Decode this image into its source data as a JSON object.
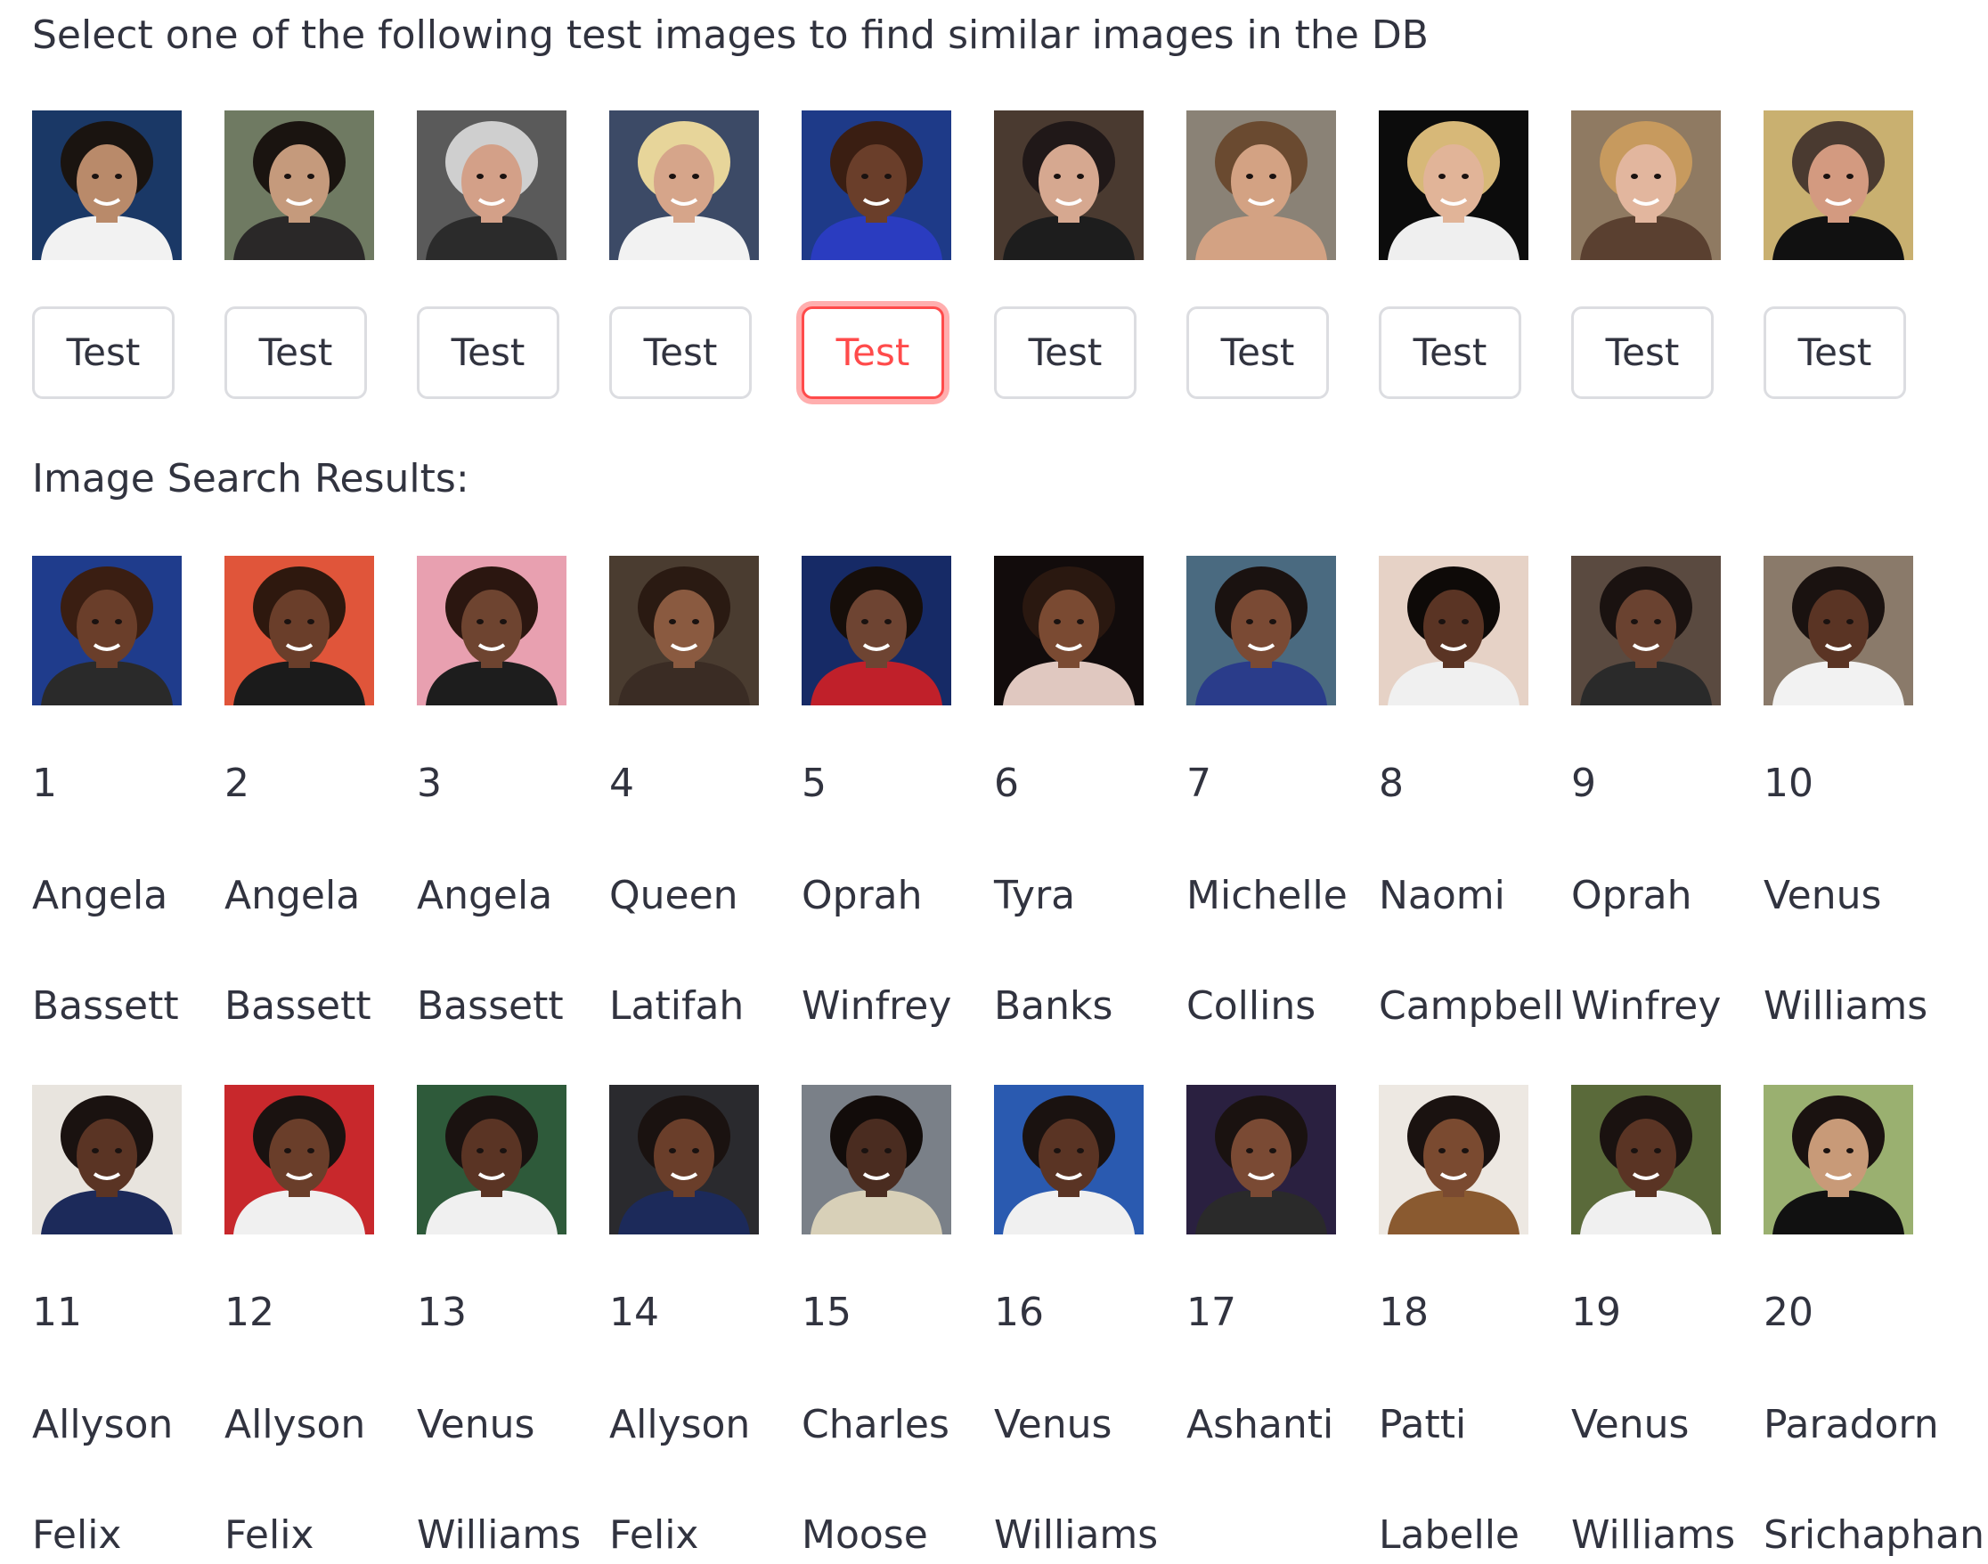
{
  "header": {
    "instruction": "Select one of the following test images to find similar images in the DB"
  },
  "test_images": [
    {
      "button_label": "Test",
      "selected": false,
      "background": "#1a3866",
      "skin": "#b98a6a",
      "hair": "#1a1410",
      "clothes": "#f2f2f2"
    },
    {
      "button_label": "Test",
      "selected": false,
      "background": "#6f7a62",
      "skin": "#c59a7c",
      "hair": "#1a1410",
      "clothes": "#2a2828"
    },
    {
      "button_label": "Test",
      "selected": false,
      "background": "#5a5a5a",
      "skin": "#d3a088",
      "hair": "#cfcfcf",
      "clothes": "#2b2b2b"
    },
    {
      "button_label": "Test",
      "selected": false,
      "background": "#3c4a66",
      "skin": "#d6a58a",
      "hair": "#e7d59a",
      "clothes": "#f2f2f2"
    },
    {
      "button_label": "Test",
      "selected": true,
      "background": "#1e3a88",
      "skin": "#6a3e2a",
      "hair": "#3a1e12",
      "clothes": "#2a3cc0"
    },
    {
      "button_label": "Test",
      "selected": false,
      "background": "#4a3a30",
      "skin": "#d6a890",
      "hair": "#201818",
      "clothes": "#1d1d1d"
    },
    {
      "button_label": "Test",
      "selected": false,
      "background": "#8a8276",
      "skin": "#d3a283",
      "hair": "#6a4a30",
      "clothes": "#d3a283"
    },
    {
      "button_label": "Test",
      "selected": false,
      "background": "#0c0c0c",
      "skin": "#e1b498",
      "hair": "#d7b878",
      "clothes": "#efefef"
    },
    {
      "button_label": "Test",
      "selected": false,
      "background": "#8f7a62",
      "skin": "#e2b69e",
      "hair": "#c79a5e",
      "clothes": "#5a4030"
    },
    {
      "button_label": "Test",
      "selected": false,
      "background": "#c9b070",
      "skin": "#d39a80",
      "hair": "#4a3a30",
      "clothes": "#111111"
    }
  ],
  "results_heading": "Image Search Results:",
  "results": [
    {
      "rank": "1",
      "first": "Angela",
      "last": "Bassett",
      "background": "#1f3c8c",
      "skin": "#6a3e2a",
      "hair": "#3a1e12",
      "clothes": "#2a2a2a"
    },
    {
      "rank": "2",
      "first": "Angela",
      "last": "Bassett",
      "background": "#e0553a",
      "skin": "#6a3e2a",
      "hair": "#2e180e",
      "clothes": "#1b1b1b"
    },
    {
      "rank": "3",
      "first": "Angela",
      "last": "Bassett",
      "background": "#e8a0b0",
      "skin": "#6e4430",
      "hair": "#2b1610",
      "clothes": "#1d1d1d"
    },
    {
      "rank": "4",
      "first": "Queen",
      "last": "Latifah",
      "background": "#4a3c30",
      "skin": "#8a5a40",
      "hair": "#2a1a12",
      "clothes": "#3a2c24"
    },
    {
      "rank": "5",
      "first": "Oprah",
      "last": "Winfrey",
      "background": "#162a66",
      "skin": "#6e4432",
      "hair": "#160e0a",
      "clothes": "#c0202a"
    },
    {
      "rank": "6",
      "first": "Tyra",
      "last": "Banks",
      "background": "#120c0c",
      "skin": "#7a4a32",
      "hair": "#2a1810",
      "clothes": "#e0c8c0"
    },
    {
      "rank": "7",
      "first": "Michelle",
      "last": "Collins",
      "background": "#4a6a80",
      "skin": "#7a4a34",
      "hair": "#1a1210",
      "clothes": "#2a3c8a"
    },
    {
      "rank": "8",
      "first": "Naomi",
      "last": "Campbell",
      "background": "#e6d2c6",
      "skin": "#5a3424",
      "hair": "#0e0a08",
      "clothes": "#f0f0f0"
    },
    {
      "rank": "9",
      "first": "Oprah",
      "last": "Winfrey",
      "background": "#5a4a40",
      "skin": "#6a4230",
      "hair": "#1a1210",
      "clothes": "#2a2a2a"
    },
    {
      "rank": "10",
      "first": "Venus",
      "last": "Williams",
      "background": "#8a7a6a",
      "skin": "#5a3424",
      "hair": "#1a1210",
      "clothes": "#f2f2f2"
    },
    {
      "rank": "11",
      "first": "Allyson",
      "last": "Felix",
      "background": "#e8e4de",
      "skin": "#5a3424",
      "hair": "#1a1210",
      "clothes": "#1c2a5a"
    },
    {
      "rank": "12",
      "first": "Allyson",
      "last": "Felix",
      "background": "#c8282c",
      "skin": "#6a3e2a",
      "hair": "#1a1210",
      "clothes": "#f0f0f0"
    },
    {
      "rank": "13",
      "first": "Venus",
      "last": "Williams",
      "background": "#2e5a3a",
      "skin": "#5a3424",
      "hair": "#1a1210",
      "clothes": "#f0f0f0"
    },
    {
      "rank": "14",
      "first": "Allyson",
      "last": "Felix",
      "background": "#2a2a2e",
      "skin": "#6a3e2a",
      "hair": "#1a1210",
      "clothes": "#1c2a5a"
    },
    {
      "rank": "15",
      "first": "Charles",
      "last": "Moose",
      "background": "#7a8088",
      "skin": "#4a2c20",
      "hair": "#120c0a",
      "clothes": "#d8d0b8"
    },
    {
      "rank": "16",
      "first": "Venus",
      "last": "Williams",
      "background": "#2a5ab0",
      "skin": "#5a3424",
      "hair": "#1a1210",
      "clothes": "#f0f0f0"
    },
    {
      "rank": "17",
      "first": "Ashanti",
      "last": "",
      "background": "#2a2040",
      "skin": "#7a4a34",
      "hair": "#1a1210",
      "clothes": "#2a2a2a"
    },
    {
      "rank": "18",
      "first": "Patti",
      "last": "Labelle",
      "background": "#ede8e2",
      "skin": "#7a4a30",
      "hair": "#1a1210",
      "clothes": "#8a5a30"
    },
    {
      "rank": "19",
      "first": "Venus",
      "last": "Williams",
      "background": "#5a6a3a",
      "skin": "#5a3424",
      "hair": "#1a1210",
      "clothes": "#f0f0f0"
    },
    {
      "rank": "20",
      "first": "Paradorn",
      "last": "Srichaphan",
      "background": "#9ab070",
      "skin": "#c89a78",
      "hair": "#1a1210",
      "clothes": "#111111"
    }
  ]
}
